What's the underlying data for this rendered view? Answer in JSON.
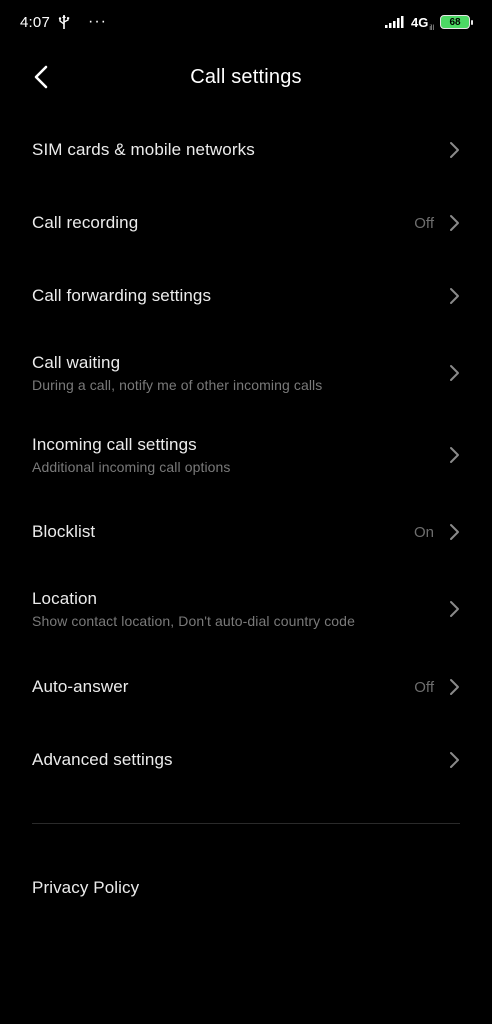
{
  "status_bar": {
    "time": "4:07",
    "overflow": "···",
    "network": "4G",
    "network_sub": "ill",
    "battery": "68",
    "usb_icon": "usb-icon",
    "signal_icon": "signal-bars-icon"
  },
  "header": {
    "title": "Call settings",
    "back_icon": "chevron-left-icon"
  },
  "items": [
    {
      "title": "SIM cards & mobile networks",
      "subtitle": "",
      "value": ""
    },
    {
      "title": "Call recording",
      "subtitle": "",
      "value": "Off"
    },
    {
      "title": "Call forwarding settings",
      "subtitle": "",
      "value": ""
    },
    {
      "title": "Call waiting",
      "subtitle": "During a call, notify me of other incoming calls",
      "value": ""
    },
    {
      "title": "Incoming call settings",
      "subtitle": "Additional incoming call options",
      "value": ""
    },
    {
      "title": "Blocklist",
      "subtitle": "",
      "value": "On"
    },
    {
      "title": "Location",
      "subtitle": "Show contact location, Don't auto-dial country code",
      "value": ""
    },
    {
      "title": "Auto-answer",
      "subtitle": "",
      "value": "Off"
    },
    {
      "title": "Advanced settings",
      "subtitle": "",
      "value": ""
    }
  ],
  "footer": {
    "privacy_policy": "Privacy Policy"
  },
  "colors": {
    "background": "#000000",
    "title_text": "#ececec",
    "secondary_text": "#7a7a7a",
    "battery": "#4cd964"
  }
}
